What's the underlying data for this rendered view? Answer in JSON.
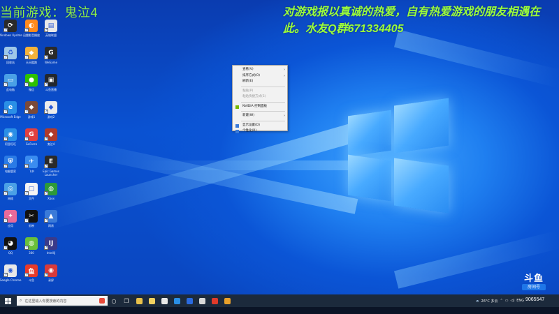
{
  "overlay": {
    "current_game": "当前游戏：鬼泣4",
    "message": "对游戏报以真诚的热爱，自有热爱游戏的朋友相遇在此。水友Q群671334405"
  },
  "desktop_icons": [
    {
      "label": "Windows Update",
      "icon": "update-icon",
      "color": "#2a2a2a",
      "glyph": "⟳"
    },
    {
      "label": "迅雷影音播放",
      "icon": "thunder-icon",
      "color": "#ff8a1c",
      "glyph": "◐"
    },
    {
      "label": "英雄联盟",
      "icon": "doc-icon",
      "color": "#e8e8e8",
      "glyph": "▤"
    },
    {
      "label": "回收站",
      "icon": "recycle-bin-icon",
      "color": "#9ec7e8",
      "glyph": "♻"
    },
    {
      "label": "天天酷跑",
      "icon": "game-icon",
      "color": "#f4b23a",
      "glyph": "◆"
    },
    {
      "label": "WeGame",
      "icon": "wegame-icon",
      "color": "#2a2a2a",
      "glyph": "G"
    },
    {
      "label": "此电脑",
      "icon": "computer-icon",
      "color": "#4aa0e6",
      "glyph": "▭"
    },
    {
      "label": "微信",
      "icon": "wechat-icon",
      "color": "#2dc100",
      "glyph": "●"
    },
    {
      "label": "斗鱼直播",
      "icon": "tv-icon",
      "color": "#22272e",
      "glyph": "▣"
    },
    {
      "label": "Microsoft Edge",
      "icon": "edge-icon",
      "color": "#2a8fe6",
      "glyph": "e"
    },
    {
      "label": "游戏1",
      "icon": "game-icon",
      "color": "#7a4a3a",
      "glyph": "◆"
    },
    {
      "label": "游戏2",
      "icon": "game-icon",
      "color": "#ececec",
      "glyph": "◆"
    },
    {
      "label": "阿里旺旺",
      "icon": "ali-icon",
      "color": "#2a8fe6",
      "glyph": "◉"
    },
    {
      "label": "GeForce",
      "icon": "g-icon",
      "color": "#e04040",
      "glyph": "G"
    },
    {
      "label": "鬼泣4",
      "icon": "dmc-icon",
      "color": "#b03a2a",
      "glyph": "◆"
    },
    {
      "label": "电脑管家",
      "icon": "shield-icon",
      "color": "#2a7be6",
      "glyph": "⛨"
    },
    {
      "label": "飞书",
      "icon": "feishu-icon",
      "color": "#3a8cf0",
      "glyph": "✈"
    },
    {
      "label": "Epic Games Launcher",
      "icon": "epic-icon",
      "color": "#2a2a2a",
      "glyph": "E"
    },
    {
      "label": "网络",
      "icon": "network-icon",
      "color": "#4aa0e6",
      "glyph": "◎"
    },
    {
      "label": "文件",
      "icon": "file-icon",
      "color": "#f4f4f4",
      "glyph": "▢"
    },
    {
      "label": "Xbox",
      "icon": "xbox-icon",
      "color": "#2d9a3a",
      "glyph": "◍"
    },
    {
      "label": "应用",
      "icon": "app-icon",
      "color": "#e86a9a",
      "glyph": "✦"
    },
    {
      "label": "剪映",
      "icon": "capcut-icon",
      "color": "#111111",
      "glyph": "✂"
    },
    {
      "label": "网易",
      "icon": "mountain-icon",
      "color": "#3a7ad8",
      "glyph": "▲"
    },
    {
      "label": "QQ",
      "icon": "qq-icon",
      "color": "#111111",
      "glyph": "◕"
    },
    {
      "label": "360",
      "icon": "360-icon",
      "color": "#6ac03a",
      "glyph": "◍"
    },
    {
      "label": "IntelliJ",
      "icon": "ij-icon",
      "color": "#3a3a8a",
      "glyph": "IJ"
    },
    {
      "label": "Google Chrome",
      "icon": "chrome-icon",
      "color": "#e8e8e8",
      "glyph": "◉"
    },
    {
      "label": "斗鱼",
      "icon": "douyu-icon",
      "color": "#e83a2a",
      "glyph": "鱼"
    },
    {
      "label": "录屏",
      "icon": "record-icon",
      "color": "#d83a3a",
      "glyph": "◉"
    }
  ],
  "context_menu": {
    "items": [
      {
        "label": "查看(V)",
        "submenu": true,
        "disabled": false
      },
      {
        "label": "排序方式(O)",
        "submenu": true,
        "disabled": false
      },
      {
        "label": "刷新(E)",
        "submenu": false,
        "disabled": false
      },
      {
        "sep": true
      },
      {
        "label": "粘贴(P)",
        "submenu": false,
        "disabled": true
      },
      {
        "label": "粘贴快捷方式(S)",
        "submenu": false,
        "disabled": true
      },
      {
        "sep": true
      },
      {
        "label": "NVIDIA 控制面板",
        "submenu": false,
        "disabled": false,
        "icon": "nvidia-icon"
      },
      {
        "sep": true
      },
      {
        "label": "新建(W)",
        "submenu": true,
        "disabled": false
      },
      {
        "sep": true
      },
      {
        "label": "显示设置(D)",
        "submenu": false,
        "disabled": false,
        "icon": "display-icon"
      },
      {
        "label": "个性化(R)",
        "submenu": false,
        "disabled": false,
        "icon": "personalize-icon"
      }
    ]
  },
  "watermark": {
    "brand": "斗鱼",
    "room_label": "房间号",
    "room_number": "9065547"
  },
  "taskbar": {
    "search_placeholder": "在这里输入你要搜索的内容",
    "weather": "26°C 多云",
    "tray_text": "ENG",
    "apps": [
      {
        "icon": "chrome-taskbar-icon",
        "color": "#e8e8e8"
      },
      {
        "icon": "edge-taskbar-icon",
        "color": "#2a8fe6"
      },
      {
        "icon": "douyu-taskbar-icon",
        "color": "#2a6ae0"
      },
      {
        "icon": "app-taskbar-icon",
        "color": "#d8d8d8"
      },
      {
        "icon": "huawei-taskbar-icon",
        "color": "#e03a2a"
      },
      {
        "icon": "game-taskbar-icon",
        "color": "#e8a02a"
      }
    ]
  },
  "colors": {
    "overlay_green": "#9cff3a",
    "taskbar_bg": "#1c2a3c",
    "menu_bg": "#f2f2f2"
  }
}
